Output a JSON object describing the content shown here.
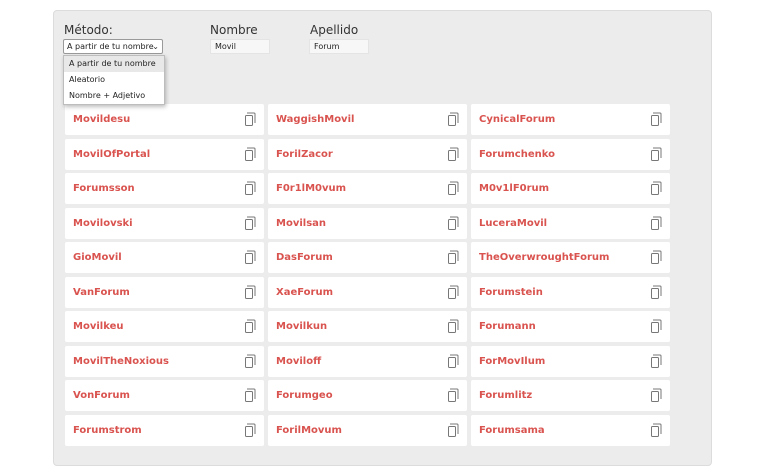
{
  "form": {
    "method_label": "Método:",
    "method_selected": "A partir de tu nombre",
    "method_options": [
      "A partir de tu nombre",
      "Aleatorio",
      "Nombre + Adjetivo"
    ],
    "first_name_label": "Nombre",
    "first_name_value": "Movil",
    "last_name_label": "Apellido",
    "last_name_value": "Forum"
  },
  "accent_color": "#d9534f",
  "copy_icon": "copy-icon",
  "results": [
    "Movildesu",
    "WaggishMovil",
    "CynicalForum",
    "MovilOfPortal",
    "ForilZacor",
    "Forumchenko",
    "Forumsson",
    "F0r1lM0vum",
    "M0v1lF0rum",
    "Movilovski",
    "Movilsan",
    "LuceraMovil",
    "GioMovil",
    "DasForum",
    "TheOverwroughtForum",
    "VanForum",
    "XaeForum",
    "Forumstein",
    "Movilkeu",
    "Movilkun",
    "Forumann",
    "MovilTheNoxious",
    "Moviloff",
    "ForMovIlum",
    "VonForum",
    "Forumgeo",
    "Forumlitz",
    "Forumstrom",
    "ForilMovum",
    "Forumsama"
  ]
}
